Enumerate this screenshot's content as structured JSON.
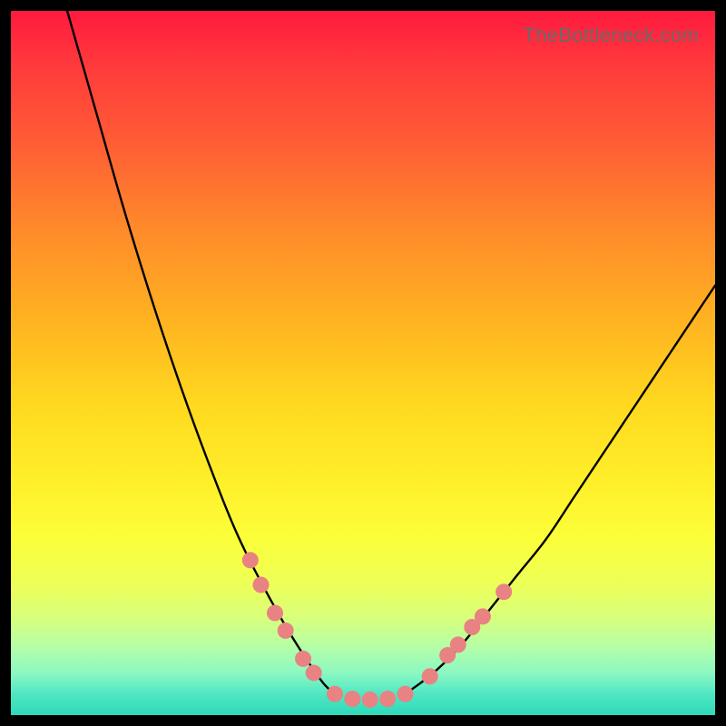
{
  "watermark": "TheBottleneck.com",
  "chart_data": {
    "type": "line",
    "title": "",
    "xlabel": "",
    "ylabel": "",
    "xlim": [
      0,
      100
    ],
    "ylim": [
      0,
      100
    ],
    "grid": false,
    "legend": false,
    "series": [
      {
        "name": "left-curve",
        "x": [
          8,
          12,
          16,
          20,
          24,
          28,
          32,
          36,
          40,
          44,
          46
        ],
        "y": [
          100,
          86,
          72,
          59,
          47,
          36,
          26,
          18,
          11,
          5,
          3
        ],
        "color": "#000000"
      },
      {
        "name": "right-curve",
        "x": [
          56,
          60,
          64,
          68,
          72,
          76,
          80,
          84,
          88,
          92,
          96,
          100
        ],
        "y": [
          3,
          6,
          10,
          15,
          20,
          25,
          31,
          37,
          43,
          49,
          55,
          61
        ],
        "color": "#000000"
      }
    ],
    "markers": {
      "name": "highlight-dots",
      "color": "#e98282",
      "radius_px": 9,
      "points": [
        {
          "x": 34,
          "y": 22
        },
        {
          "x": 35.5,
          "y": 18.5
        },
        {
          "x": 37.5,
          "y": 14.5
        },
        {
          "x": 39,
          "y": 12
        },
        {
          "x": 41.5,
          "y": 8
        },
        {
          "x": 43,
          "y": 6
        },
        {
          "x": 46,
          "y": 3
        },
        {
          "x": 48.5,
          "y": 2.3
        },
        {
          "x": 51,
          "y": 2.2
        },
        {
          "x": 53.5,
          "y": 2.3
        },
        {
          "x": 56,
          "y": 3
        },
        {
          "x": 59.5,
          "y": 5.5
        },
        {
          "x": 62,
          "y": 8.5
        },
        {
          "x": 63.5,
          "y": 10
        },
        {
          "x": 65.5,
          "y": 12.5
        },
        {
          "x": 67,
          "y": 14
        },
        {
          "x": 70,
          "y": 17.5
        }
      ]
    }
  }
}
